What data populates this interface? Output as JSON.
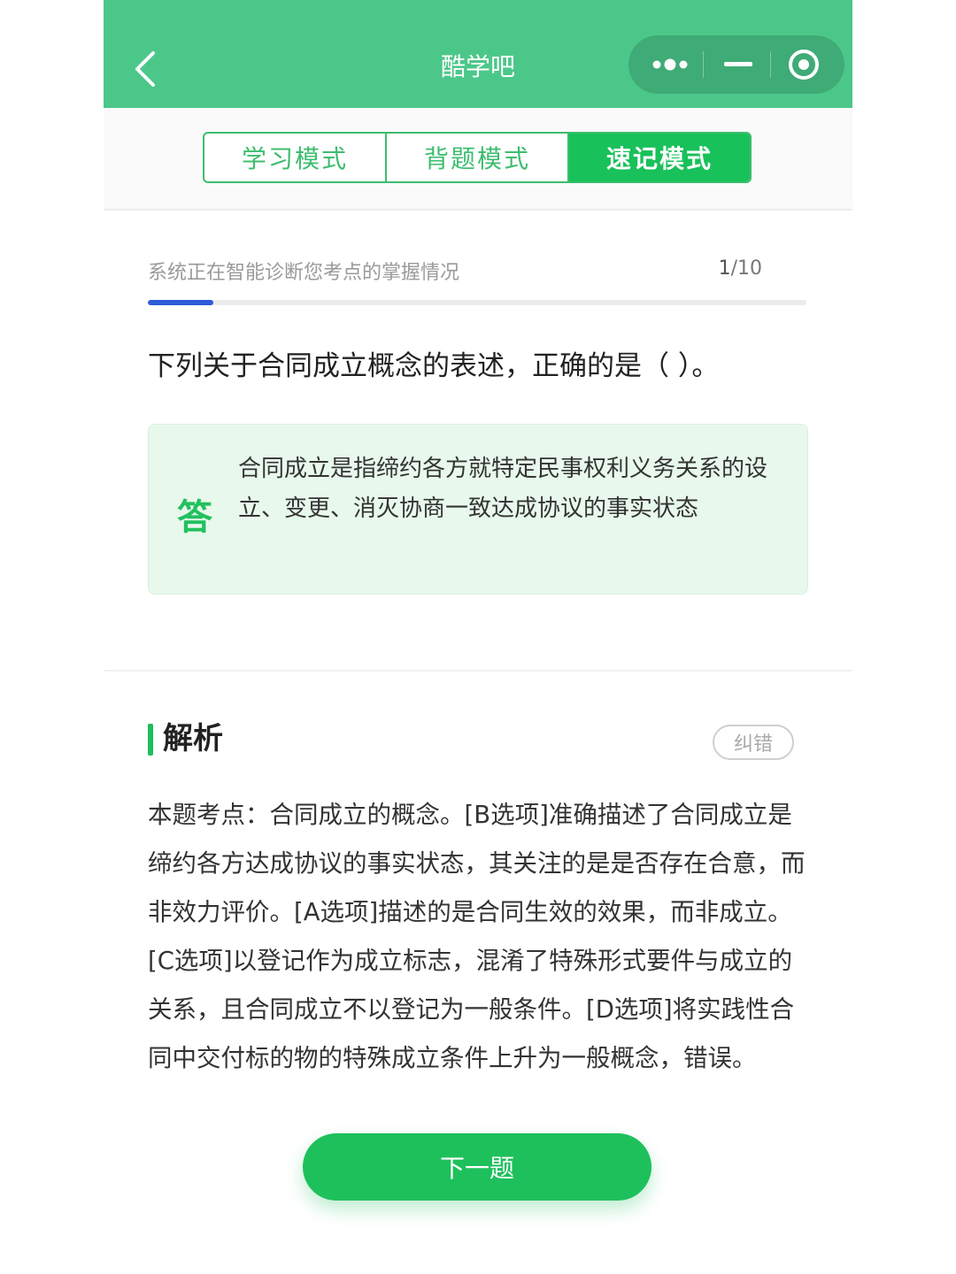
{
  "header": {
    "title": "酷学吧",
    "icons": [
      "back-icon",
      "more-dots-icon",
      "minimize-icon",
      "close-target-icon"
    ]
  },
  "modes": {
    "tabs": [
      {
        "label": "学习模式",
        "active": false
      },
      {
        "label": "背题模式",
        "active": false
      },
      {
        "label": "速记模式",
        "active": true
      }
    ]
  },
  "progress": {
    "status_text": "系统正在智能诊断您考点的掌握情况",
    "current": "1",
    "total": "/10",
    "fraction": 0.1
  },
  "question": {
    "text": "下列关于合同成立概念的表述，正确的是（ ）。"
  },
  "answer": {
    "mark": "答",
    "text": "合同成立是指缔约各方就特定民事权利义务关系的设立、变更、消灭协商一致达成协议的事实状态"
  },
  "analysis": {
    "title": "解析",
    "report_label": "纠错",
    "text": "本题考点：合同成立的概念。[B选项]准确描述了合同成立是缔约各方达成协议的事实状态，其关注的是是否存在合意，而非效力评价。[A选项]描述的是合同生效的效果，而非成立。[C选项]以登记作为成立标志，混淆了特殊形式要件与成立的关系，且合同成立不以登记为一般条件。[D选项]将实践性合同中交付标的物的特殊成立条件上升为一般概念，错误。"
  },
  "footer": {
    "next_label": "下一题"
  },
  "colors": {
    "header_bg": "#4cc78a",
    "accent_green": "#18c15a",
    "progress_blue": "#2f5bd8",
    "answer_bg": "#e8f8ec"
  }
}
